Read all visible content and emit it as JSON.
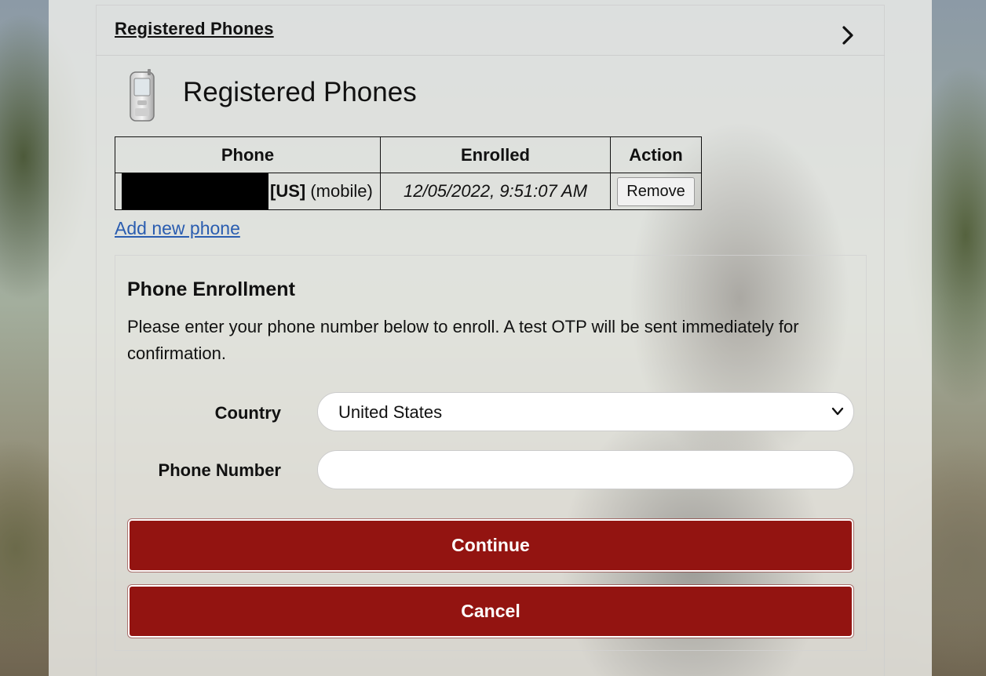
{
  "header": {
    "title": "Registered Phones",
    "expand_icon": "chevron-right-icon"
  },
  "registered": {
    "icon": "mobile-phone-icon",
    "title": "Registered Phones",
    "table": {
      "headers": [
        "Phone",
        "Enrolled",
        "Action"
      ],
      "rows": [
        {
          "country_code": "[US]",
          "type": "(mobile)",
          "enrolled": "12/05/2022, 9:51:07 AM",
          "action_label": "Remove"
        }
      ]
    },
    "add_link": "Add new phone"
  },
  "enrollment": {
    "title": "Phone Enrollment",
    "description": "Please enter your phone number below to enroll. A test OTP will be sent immediately for confirmation.",
    "country_label": "Country",
    "country_value": "United States",
    "phone_label": "Phone Number",
    "phone_value": "",
    "continue_label": "Continue",
    "cancel_label": "Cancel"
  },
  "colors": {
    "primary_button": "#931411",
    "link": "#2a5db0"
  }
}
